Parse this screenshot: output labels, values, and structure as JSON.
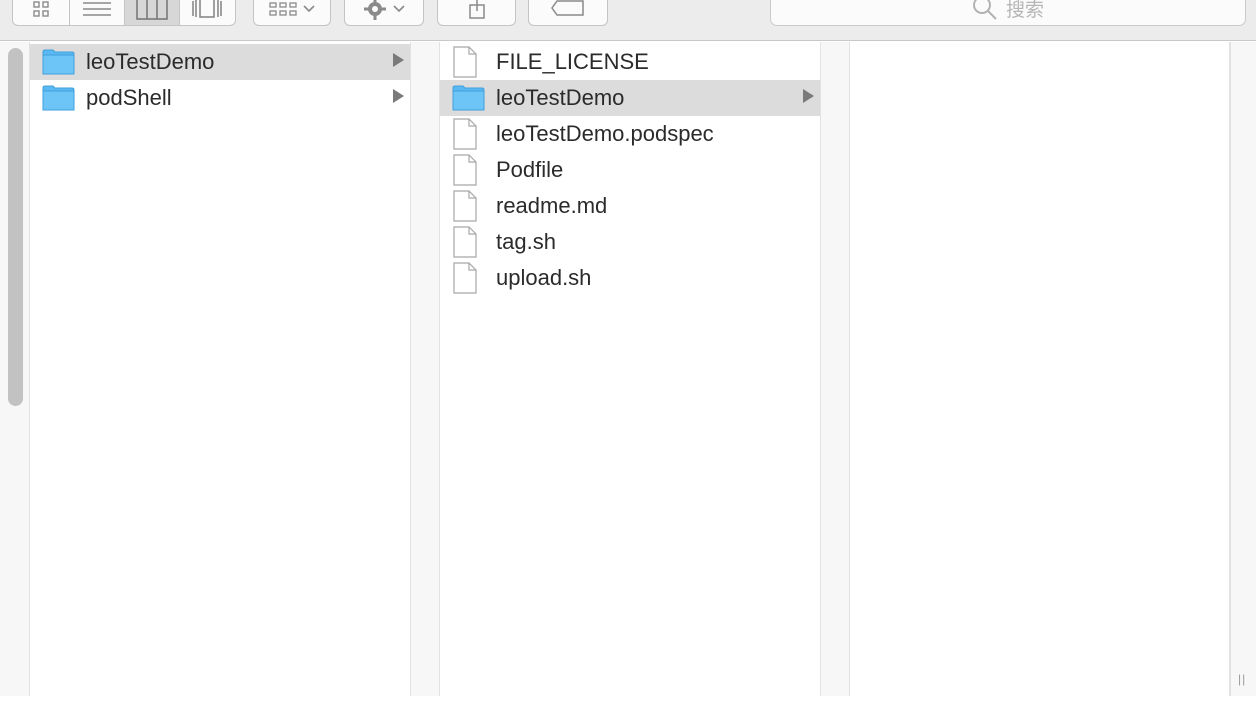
{
  "toolbar": {
    "view_buttons": [
      "icon-view",
      "list-view",
      "column-view",
      "cover-flow-view"
    ],
    "active_view": "column-view",
    "search": {
      "placeholder": "搜索"
    }
  },
  "columns": [
    {
      "items": [
        {
          "label": "leoTestDemo",
          "type": "folder",
          "selected": true,
          "has_children": true
        },
        {
          "label": "podShell",
          "type": "folder",
          "selected": false,
          "has_children": true
        }
      ]
    },
    {
      "items": [
        {
          "label": "FILE_LICENSE",
          "type": "file",
          "selected": false,
          "has_children": false
        },
        {
          "label": "leoTestDemo",
          "type": "folder",
          "selected": true,
          "has_children": true
        },
        {
          "label": "leoTestDemo.podspec",
          "type": "file",
          "selected": false,
          "has_children": false
        },
        {
          "label": "Podfile",
          "type": "file",
          "selected": false,
          "has_children": false
        },
        {
          "label": "readme.md",
          "type": "file",
          "selected": false,
          "has_children": false
        },
        {
          "label": "tag.sh",
          "type": "file",
          "selected": false,
          "has_children": false
        },
        {
          "label": "upload.sh",
          "type": "file",
          "selected": false,
          "has_children": false
        }
      ]
    },
    {
      "items": []
    }
  ],
  "colors": {
    "folder": "#5ab8f2",
    "selection": "#dcdcdc",
    "text": "#2b2b2b"
  }
}
